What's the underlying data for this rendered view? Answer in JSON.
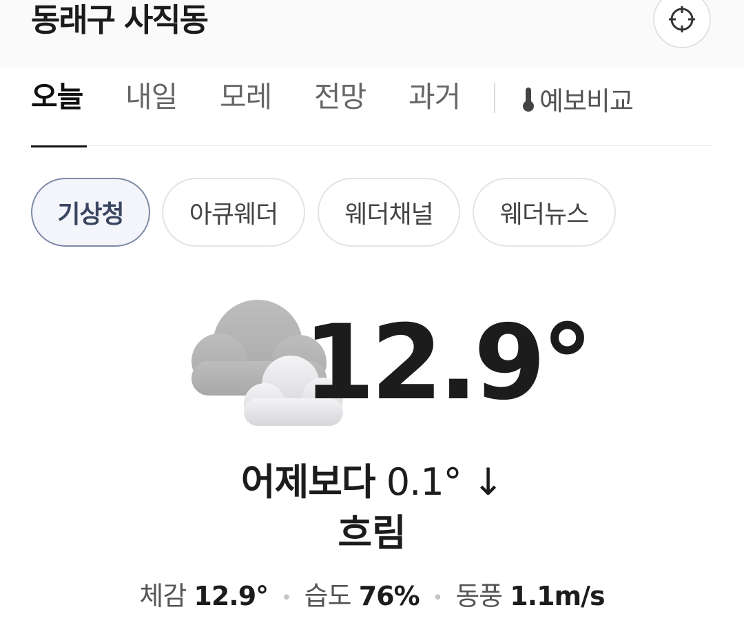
{
  "header": {
    "location": "동래구 사직동",
    "locate_icon": "crosshair-icon"
  },
  "tabs": {
    "items": [
      "오늘",
      "내일",
      "모레",
      "전망",
      "과거"
    ],
    "active": "오늘",
    "compare_label": "예보비교",
    "compare_icon": "thermometer-icon"
  },
  "sources": {
    "items": [
      "기상청",
      "아큐웨더",
      "웨더채널",
      "웨더뉴스"
    ],
    "active": "기상청"
  },
  "current": {
    "icon": "cloudy-icon",
    "temperature": "12.9°",
    "compare_label": "어제보다",
    "compare_value": "0.1°",
    "compare_arrow": "↓",
    "condition": "흐림"
  },
  "details": {
    "feels_label": "체감",
    "feels_value": "12.9°",
    "humidity_label": "습도",
    "humidity_value": "76%",
    "wind_label": "동풍",
    "wind_value": "1.1m/s",
    "separator": "•"
  },
  "colors": {
    "active_chip_border": "#7d8aa6",
    "active_chip_bg": "#f3f5fa",
    "text_primary": "#1c1c1c",
    "text_secondary": "#555555"
  }
}
